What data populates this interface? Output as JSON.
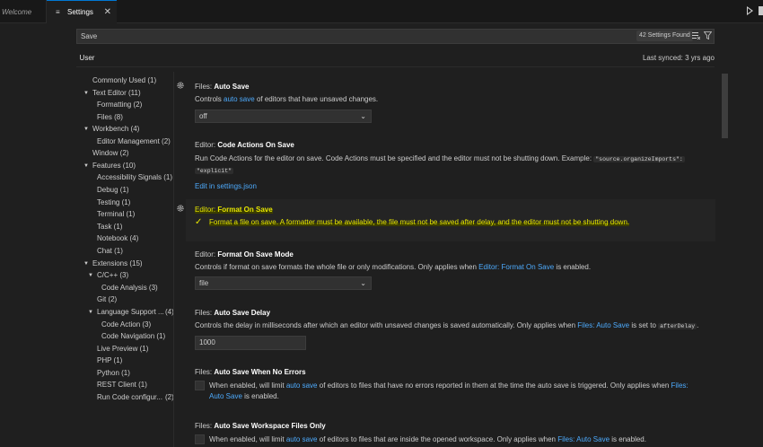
{
  "tabs": {
    "welcome": "Welcome",
    "settings": "Settings"
  },
  "search": {
    "value": "Save",
    "count": "42 Settings Found"
  },
  "scope": {
    "user_tab": "User",
    "last_synced": "Last synced: 3 yrs ago"
  },
  "toc": [
    {
      "label": "Commonly Used (1)"
    },
    {
      "label": "Text Editor (11)"
    },
    {
      "label": "Formatting (2)"
    },
    {
      "label": "Files (8)"
    },
    {
      "label": "Workbench (4)"
    },
    {
      "label": "Editor Management (2)"
    },
    {
      "label": "Window (2)"
    },
    {
      "label": "Features (10)"
    },
    {
      "label": "Accessibility Signals (1)"
    },
    {
      "label": "Debug (1)"
    },
    {
      "label": "Testing (1)"
    },
    {
      "label": "Terminal (1)"
    },
    {
      "label": "Task (1)"
    },
    {
      "label": "Notebook (4)"
    },
    {
      "label": "Chat (1)"
    },
    {
      "label": "Extensions (15)"
    },
    {
      "label": "C/C++ (3)"
    },
    {
      "label": "Code Analysis (3)"
    },
    {
      "label": "Git (2)"
    },
    {
      "label": "Language Support ...",
      "count": "(4)"
    },
    {
      "label": "Code Action (3)"
    },
    {
      "label": "Code Navigation (1)"
    },
    {
      "label": "Live Preview (1)"
    },
    {
      "label": "PHP (1)"
    },
    {
      "label": "Python (1)"
    },
    {
      "label": "REST Client (1)"
    },
    {
      "label": "Run Code configur...",
      "count": "(2)"
    }
  ],
  "settings": {
    "auto_save": {
      "category": "Files: ",
      "name": "Auto Save",
      "desc_pre": "Controls ",
      "desc_link": "auto save",
      "desc_post": " of editors that have unsaved changes.",
      "value": "off"
    },
    "code_actions": {
      "category": "Editor: ",
      "name": "Code Actions On Save",
      "desc": "Run Code Actions for the editor on save. Code Actions must be specified and the editor must not be shutting down. Example: ",
      "code1": "\"source.organizeImports\":",
      "code2": "\"explicit\"",
      "edit_link": "Edit in settings.json"
    },
    "format_on_save": {
      "category": "Editor: ",
      "name": "Format On Save",
      "desc": "Format a file on save. A formatter must be available, the file must not be saved after delay, and the editor must not be shutting down.",
      "checked": true
    },
    "format_on_save_mode": {
      "category": "Editor: ",
      "name": "Format On Save Mode",
      "desc_pre": "Controls if format on save formats the whole file or only modifications. Only applies when ",
      "desc_link": "Editor: Format On Save",
      "desc_post": " is enabled.",
      "value": "file"
    },
    "auto_save_delay": {
      "category": "Files: ",
      "name": "Auto Save Delay",
      "desc_pre": "Controls the delay in milliseconds after which an editor with unsaved changes is saved automatically. Only applies when ",
      "desc_link": "Files: Auto Save",
      "desc_mid": " is set to ",
      "desc_code": "afterDelay",
      "desc_post": ".",
      "value": "1000"
    },
    "auto_save_no_errors": {
      "category": "Files: ",
      "name": "Auto Save When No Errors",
      "desc_pre": "When enabled, will limit ",
      "desc_link": "auto save",
      "desc_mid": " of editors to files that have no errors reported in them at the time the auto save is triggered. Only applies when ",
      "desc_link2a": "Files:",
      "desc_link2b": "Auto Save",
      "desc_post": " is enabled."
    },
    "auto_save_workspace": {
      "category": "Files: ",
      "name": "Auto Save Workspace Files Only",
      "desc_pre": "When enabled, will limit ",
      "desc_link": "auto save",
      "desc_mid": " of editors to files that are inside the opened workspace. Only applies when ",
      "desc_link2": "Files: Auto Save",
      "desc_post": " is enabled."
    }
  }
}
